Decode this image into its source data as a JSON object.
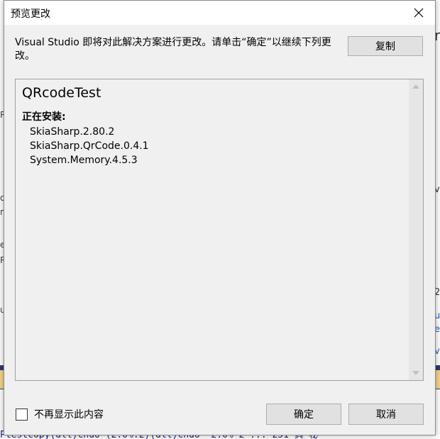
{
  "dialog": {
    "title": "预览更改",
    "description": "Visual Studio 即将对此解决方案进行更改。请单击“确定”以继续下列更改。",
    "copy_label": "复制",
    "project_name": "QRcodeTest",
    "section_installing": "正在安装:",
    "packages": [
      "SkiaSharp.2.80.2",
      "SkiaSharp.QrCode.0.4.1",
      "System.Memory.4.5.3"
    ],
    "dont_show_label": "不再显示此内容",
    "ok_label": "确定",
    "cancel_label": "取消"
  },
  "background": {
    "right_fragments": [
      "r",
      "v",
      "2",
      "u",
      "e",
      "v."
    ],
    "left_fragments": [
      "R",
      "o",
      "n",
      "e",
      "R",
      "u"
    ],
    "bottom_code": "Ptestcopy(dll)chdo_(2.0%.2)(dll)chdo_ 2.0% 2 ... 251 真 秘"
  },
  "colors": {
    "dialog_bg": "#f0f0f0",
    "titlebar_bg": "#ffffff",
    "button_bg": "#e1e1e1",
    "button_border": "#adadad"
  }
}
